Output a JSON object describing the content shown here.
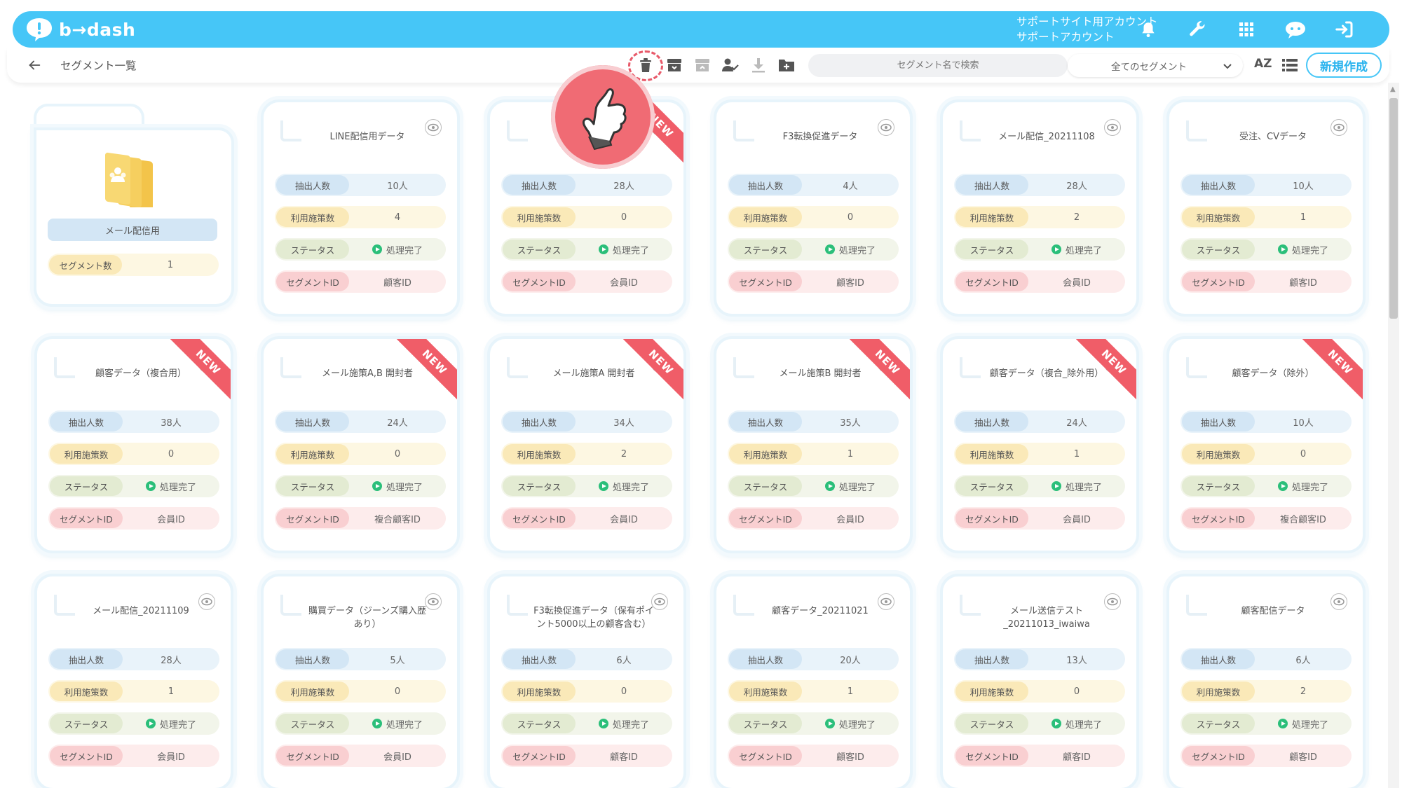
{
  "header": {
    "logo_text": "b→dash",
    "account_line1": "サポートサイト用アカウント",
    "account_line2": "サポートアカウント",
    "icons": [
      "bell-icon",
      "wrench-icon",
      "grid-apps-icon",
      "chat-bot-icon",
      "logout-icon"
    ]
  },
  "toolbar": {
    "page_title": "セグメント一覧",
    "search_placeholder": "セグメント名で検索",
    "filter_selected": "全てのセグメント",
    "sort_label": "AZ",
    "new_button": "新規作成",
    "tool_icons": [
      "trash-icon",
      "archive-icon",
      "unarchive-icon",
      "user-check-icon",
      "download-icon",
      "add-folder-icon"
    ]
  },
  "labels": {
    "extract": "抽出人数",
    "usage": "利用施策数",
    "status": "ステータス",
    "segment_id": "セグメントID",
    "segment_count": "セグメント数",
    "new_badge": "NEW"
  },
  "folder": {
    "name": "メール配信用",
    "segment_count": "1"
  },
  "cards": [
    {
      "title": "LINE配信用データ",
      "extract": "10人",
      "usage": "4",
      "status": "処理完了",
      "id": "顧客ID",
      "new": false
    },
    {
      "title": "",
      "extract": "28人",
      "usage": "0",
      "status": "処理完了",
      "id": "会員ID",
      "new": true
    },
    {
      "title": "F3転換促進データ",
      "extract": "4人",
      "usage": "0",
      "status": "処理完了",
      "id": "顧客ID",
      "new": false
    },
    {
      "title": "メール配信_20211108",
      "extract": "28人",
      "usage": "2",
      "status": "処理完了",
      "id": "会員ID",
      "new": false
    },
    {
      "title": "受注、CVデータ",
      "extract": "10人",
      "usage": "1",
      "status": "処理完了",
      "id": "顧客ID",
      "new": false
    },
    {
      "title": "顧客データ（複合用）",
      "extract": "38人",
      "usage": "0",
      "status": "処理完了",
      "id": "会員ID",
      "new": true
    },
    {
      "title": "メール施策A,B 開封者",
      "extract": "24人",
      "usage": "0",
      "status": "処理完了",
      "id": "複合顧客ID",
      "new": true
    },
    {
      "title": "メール施策A 開封者",
      "extract": "34人",
      "usage": "2",
      "status": "処理完了",
      "id": "会員ID",
      "new": true
    },
    {
      "title": "メール施策B 開封者",
      "extract": "35人",
      "usage": "1",
      "status": "処理完了",
      "id": "会員ID",
      "new": true
    },
    {
      "title": "顧客データ（複合_除外用）",
      "extract": "24人",
      "usage": "1",
      "status": "処理完了",
      "id": "会員ID",
      "new": true
    },
    {
      "title": "顧客データ（除外）",
      "extract": "10人",
      "usage": "0",
      "status": "処理完了",
      "id": "複合顧客ID",
      "new": true
    },
    {
      "title": "メール配信_20211109",
      "extract": "28人",
      "usage": "1",
      "status": "処理完了",
      "id": "会員ID",
      "new": false
    },
    {
      "title": "購買データ（ジーンズ購入歴あり）",
      "extract": "5人",
      "usage": "0",
      "status": "処理完了",
      "id": "会員ID",
      "new": false
    },
    {
      "title": "F3転換促進データ（保有ポイント5000以上の顧客含む）",
      "extract": "6人",
      "usage": "0",
      "status": "処理完了",
      "id": "顧客ID",
      "new": false
    },
    {
      "title": "顧客データ_20211021",
      "extract": "20人",
      "usage": "1",
      "status": "処理完了",
      "id": "顧客ID",
      "new": false
    },
    {
      "title": "メール送信テスト_20211013_iwaiwa",
      "extract": "13人",
      "usage": "0",
      "status": "処理完了",
      "id": "顧客ID",
      "new": false
    },
    {
      "title": "顧客配信データ",
      "extract": "6人",
      "usage": "2",
      "status": "処理完了",
      "id": "顧客ID",
      "new": false
    }
  ]
}
